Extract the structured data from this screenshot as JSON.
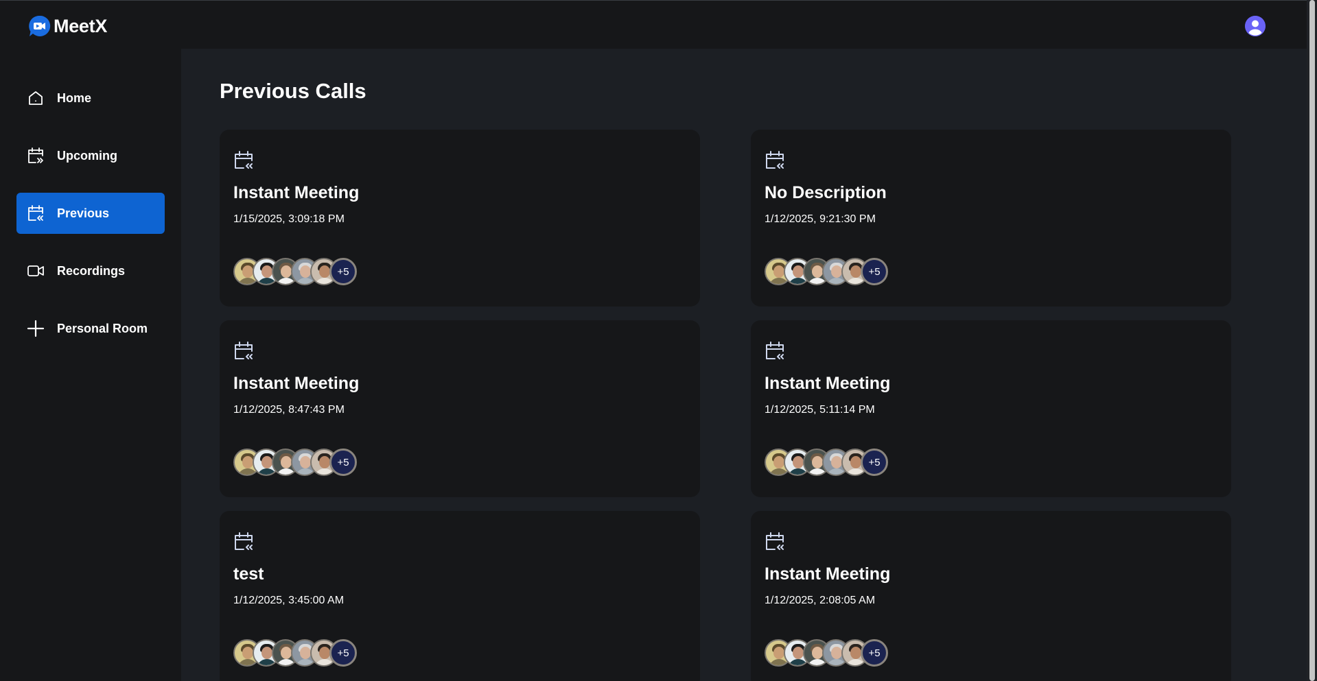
{
  "app": {
    "name": "MeetX",
    "accent_color": "#0e64d2",
    "avatar_color": "#6a63f6"
  },
  "sidebar": {
    "items": [
      {
        "label": "Home",
        "icon": "home-icon",
        "active": false
      },
      {
        "label": "Upcoming",
        "icon": "calendar-upcoming-icon",
        "active": false
      },
      {
        "label": "Previous",
        "icon": "calendar-previous-icon",
        "active": true
      },
      {
        "label": "Recordings",
        "icon": "video-icon",
        "active": false
      },
      {
        "label": "Personal Room",
        "icon": "plus-icon",
        "active": false
      }
    ]
  },
  "main": {
    "title": "Previous Calls",
    "calls": [
      {
        "title": "Instant Meeting",
        "date": "1/15/2025, 3:09:18 PM",
        "more_count": "+5"
      },
      {
        "title": "No Description",
        "date": "1/12/2025, 9:21:30 PM",
        "more_count": "+5"
      },
      {
        "title": "Instant Meeting",
        "date": "1/12/2025, 8:47:43 PM",
        "more_count": "+5"
      },
      {
        "title": "Instant Meeting",
        "date": "1/12/2025, 5:11:14 PM",
        "more_count": "+5"
      },
      {
        "title": "test",
        "date": "1/12/2025, 3:45:00 AM",
        "more_count": "+5"
      },
      {
        "title": "Instant Meeting",
        "date": "1/12/2025, 2:08:05 AM",
        "more_count": "+5"
      }
    ]
  }
}
